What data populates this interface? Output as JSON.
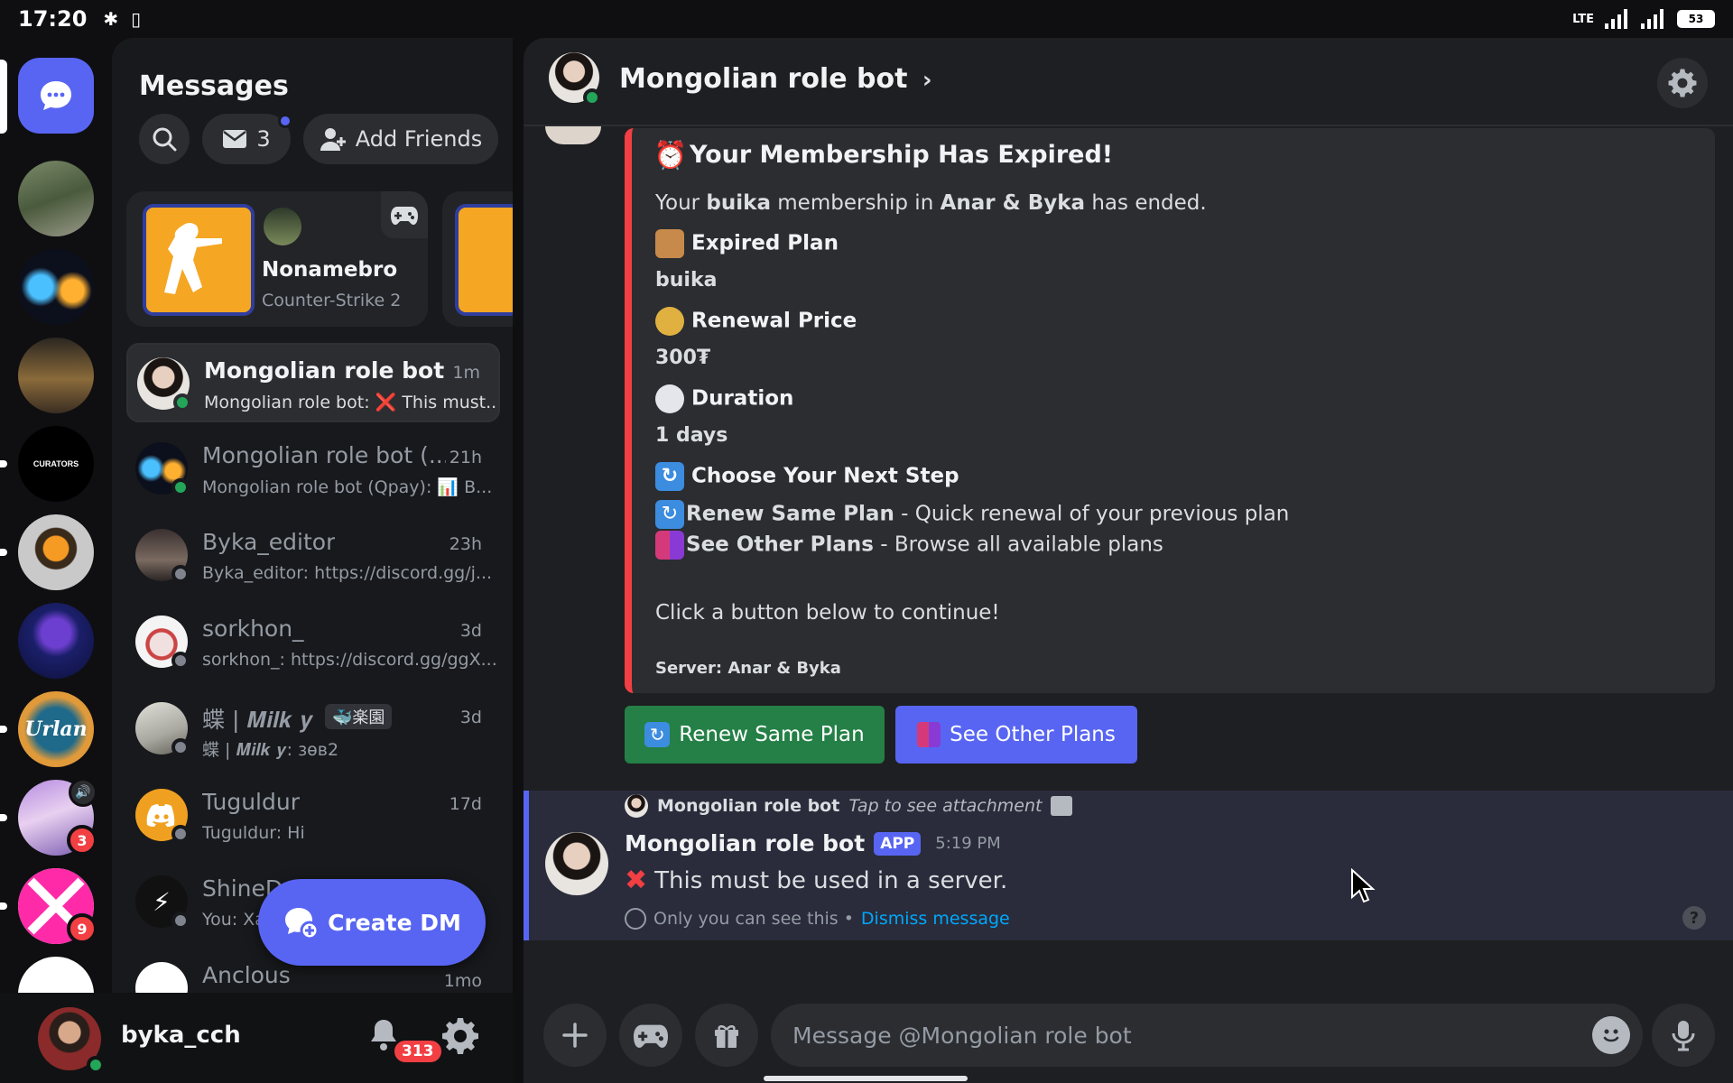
{
  "status_bar": {
    "time": "17:20",
    "network": "LTE",
    "battery": "53"
  },
  "dm_panel": {
    "title": "Messages",
    "mail_count": "3",
    "add_friends_label": "Add Friends",
    "activity": {
      "user": "Nonamebro",
      "game": "Counter-Strike 2"
    },
    "dms": [
      {
        "name": "Mongolian role bot",
        "time": "1m",
        "preview": "Mongolian role bot: ❌ This must...",
        "status": "online"
      },
      {
        "name": "Mongolian role bot (...",
        "time": "21h",
        "preview": "Mongolian role bot (Qpay): 📊 B...",
        "status": "online"
      },
      {
        "name": "Byka_editor",
        "time": "23h",
        "preview": "Byka_editor: https://discord.gg/j...",
        "status": "offline"
      },
      {
        "name": "sorkhon_",
        "time": "3d",
        "preview": "sorkhon_: https://discord.gg/ggX...",
        "status": "offline"
      },
      {
        "name": "蝶 | 𝑴𝒊𝒍𝒌 𝒚",
        "tag": "🐳楽園",
        "time": "3d",
        "preview": "蝶 | 𝑴𝒊𝒍𝒌 𝒚: зөв2",
        "status": "offline"
      },
      {
        "name": "Tuguldur",
        "time": "17d",
        "preview": "Tuguldur: Hi",
        "status": "offline"
      },
      {
        "name": "ShineD",
        "time": "",
        "preview": "You: Xa",
        "status": "offline"
      },
      {
        "name": "Anclous",
        "time": "1mo",
        "preview": "",
        "status": "offline"
      }
    ],
    "create_dm_label": "Create DM"
  },
  "rail": {
    "badges": [
      "3",
      "9"
    ]
  },
  "user_bar": {
    "username": "byka_cch",
    "notifications": "313"
  },
  "chat": {
    "title": "Mongolian role bot",
    "embed": {
      "title": "Your Membership Has Expired!",
      "intro_1": "Your ",
      "intro_bold_1": "buika",
      "intro_2": " membership in ",
      "intro_bold_2": "Anar & Byka",
      "intro_3": " has ended.",
      "field_plan": "Expired Plan",
      "value_plan": "buika",
      "field_price": "Renewal Price",
      "value_price": "300₮",
      "field_duration": "Duration",
      "value_duration": "1 days",
      "field_next": "Choose Your Next Step",
      "option_1_bold": "Renew Same Plan",
      "option_1_text": " - Quick renewal of your previous plan",
      "option_2_bold": "See Other Plans",
      "option_2_text": " - Browse all available plans",
      "cta": "Click a button below to continue!",
      "footer": "Server: Anar & Byka"
    },
    "buttons": {
      "renew": "Renew Same Plan",
      "other": "See Other Plans"
    },
    "reply": {
      "author": "Mongolian role bot",
      "hint": "Tap to see attachment"
    },
    "message": {
      "author": "Mongolian role bot",
      "badge": "APP",
      "time": "5:19 PM",
      "text": "This must be used in a server.",
      "ephemeral_note": "Only you can see this •",
      "dismiss": "Dismiss message"
    },
    "composer_placeholder": "Message @Mongolian role bot"
  },
  "colors": {
    "accent": "#5865f2",
    "success": "#248046",
    "danger": "#f23f43",
    "online": "#23a55a"
  }
}
